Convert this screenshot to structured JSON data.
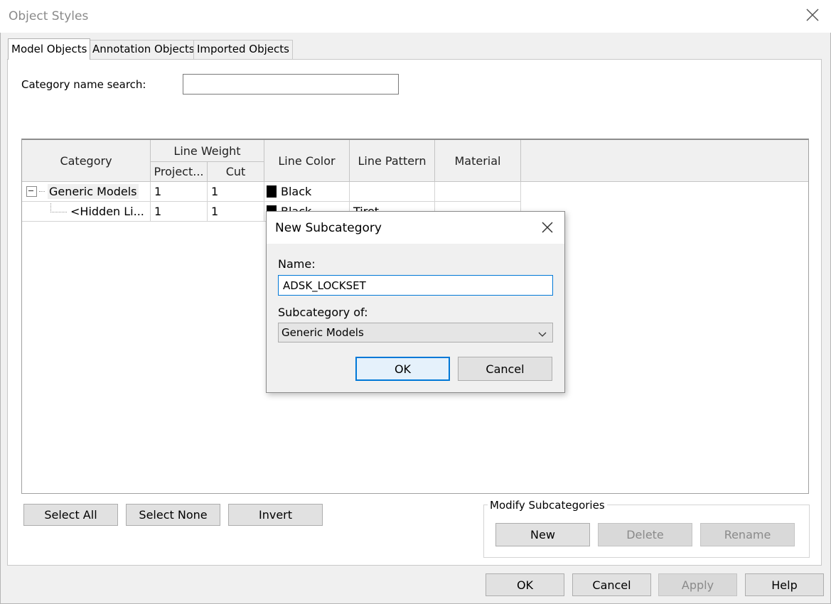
{
  "window": {
    "title": "Object Styles"
  },
  "tabs": [
    "Model Objects",
    "Annotation Objects",
    "Imported Objects"
  ],
  "search": {
    "label": "Category name search:",
    "value": ""
  },
  "grid": {
    "headers": {
      "category": "Category",
      "line_weight": "Line Weight",
      "projection": "Project...",
      "cut": "Cut",
      "line_color": "Line Color",
      "line_pattern": "Line Pattern",
      "material": "Material"
    },
    "rows": [
      {
        "category": "Generic Models",
        "projection": "1",
        "cut": "1",
        "line_color": "Black",
        "line_pattern": "",
        "material": ""
      },
      {
        "category": "<Hidden Li...",
        "projection": "1",
        "cut": "1",
        "line_color": "Black",
        "line_pattern": "Tiret",
        "material": ""
      }
    ]
  },
  "selection_buttons": {
    "select_all": "Select All",
    "select_none": "Select None",
    "invert": "Invert"
  },
  "modify_subcategories": {
    "legend": "Modify Subcategories",
    "new": "New",
    "delete": "Delete",
    "rename": "Rename"
  },
  "footer_buttons": {
    "ok": "OK",
    "cancel": "Cancel",
    "apply": "Apply",
    "help": "Help"
  },
  "dialog": {
    "title": "New Subcategory",
    "name_label": "Name:",
    "name_value": "ADSK_LOCKSET",
    "subcategory_label": "Subcategory of:",
    "subcategory_value": "Generic Models",
    "ok": "OK",
    "cancel": "Cancel"
  },
  "colors": {
    "accent": "#0078d7",
    "swatch": "#000000"
  }
}
